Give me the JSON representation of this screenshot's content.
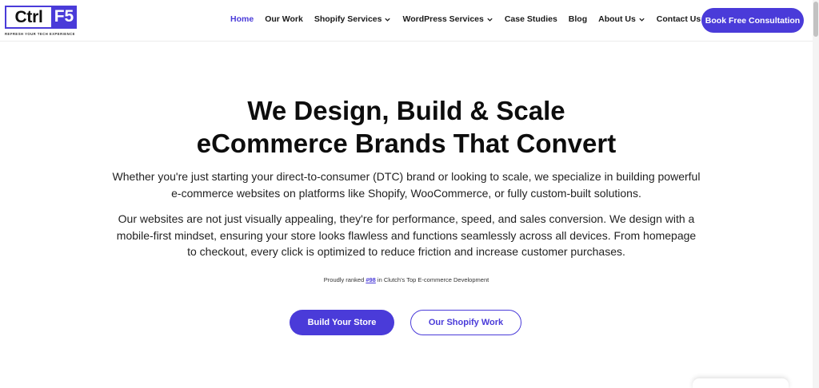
{
  "logo": {
    "ctrl": "Ctrl",
    "f5": "F5",
    "tagline": "REFRESH YOUR TECH EXPERIENCE"
  },
  "nav": {
    "items": [
      {
        "label": "Home",
        "active": true,
        "dropdown": false
      },
      {
        "label": "Our Work",
        "active": false,
        "dropdown": false
      },
      {
        "label": "Shopify Services",
        "active": false,
        "dropdown": true
      },
      {
        "label": "WordPress Services",
        "active": false,
        "dropdown": true
      },
      {
        "label": "Case Studies",
        "active": false,
        "dropdown": false
      },
      {
        "label": "Blog",
        "active": false,
        "dropdown": false
      },
      {
        "label": "About Us",
        "active": false,
        "dropdown": true
      },
      {
        "label": "Contact Us",
        "active": false,
        "dropdown": false
      }
    ],
    "cta": "Book Free Consultation"
  },
  "hero": {
    "title_line1": "We Design, Build & Scale",
    "title_line2": "eCommerce Brands That Convert",
    "paragraph1": "Whether you're just starting your direct-to-consumer (DTC) brand or looking to scale, we specialize in building powerful e-commerce websites on platforms like Shopify, WooCommerce, or fully custom-built solutions.",
    "paragraph2": "Our websites are not just visually appealing, they're for performance, speed, and sales conversion. We design with a mobile-first mindset, ensuring your store looks flawless and functions seamlessly across all devices. From homepage to checkout, every click is optimized to reduce friction and increase customer purchases.",
    "ranked_prefix": "Proudly ranked ",
    "ranked_link": "#98",
    "ranked_suffix": " in Clutch's Top E-commerce Development",
    "primary_button": "Build Your Store",
    "secondary_button": "Our Shopify Work"
  },
  "colors": {
    "accent": "#4a3bd9",
    "text": "#111111",
    "background": "#ffffff"
  }
}
